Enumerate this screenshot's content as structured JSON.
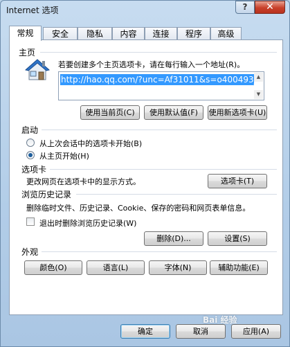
{
  "window": {
    "title": "Internet 选项",
    "help_glyph": "?",
    "close_glyph": "✕"
  },
  "tabs": [
    {
      "label": "常规",
      "active": true
    },
    {
      "label": "安全"
    },
    {
      "label": "隐私"
    },
    {
      "label": "内容"
    },
    {
      "label": "连接"
    },
    {
      "label": "程序"
    },
    {
      "label": "高级"
    }
  ],
  "home": {
    "section": "主页",
    "instruction": "若要创建多个主页选项卡，请在每行输入一个地址(R)。",
    "url": "http://hao.qq.com/?unc=Af31011&s=o400493_",
    "buttons": {
      "use_current": "使用当前页(C)",
      "use_default": "使用默认值(F)",
      "use_new_tab": "使用新选项卡(U)"
    }
  },
  "startup": {
    "section": "启动",
    "options": [
      {
        "label": "从上次会话中的选项卡开始(B)",
        "selected": false
      },
      {
        "label": "从主页开始(H)",
        "selected": true
      }
    ]
  },
  "tabs_section": {
    "section": "选项卡",
    "description": "更改网页在选项卡中的显示方式。",
    "button": "选项卡(T)"
  },
  "history": {
    "section": "浏览历史记录",
    "description": "删除临时文件、历史记录、Cookie、保存的密码和网页表单信息。",
    "checkbox": {
      "label": "退出时删除浏览历史记录(W)",
      "checked": false
    },
    "buttons": {
      "delete": "删除(D)...",
      "settings": "设置(S)"
    }
  },
  "appearance": {
    "section": "外观",
    "buttons": {
      "colors": "颜色(O)",
      "languages": "语言(L)",
      "fonts": "字体(N)",
      "accessibility": "辅助功能(E)"
    }
  },
  "footer": {
    "ok": "确定",
    "cancel": "取消",
    "apply": "应用(A)"
  },
  "watermark": "Bai 经验",
  "colors": {
    "selection": "#3399ff",
    "close_red": "#c8402a"
  }
}
